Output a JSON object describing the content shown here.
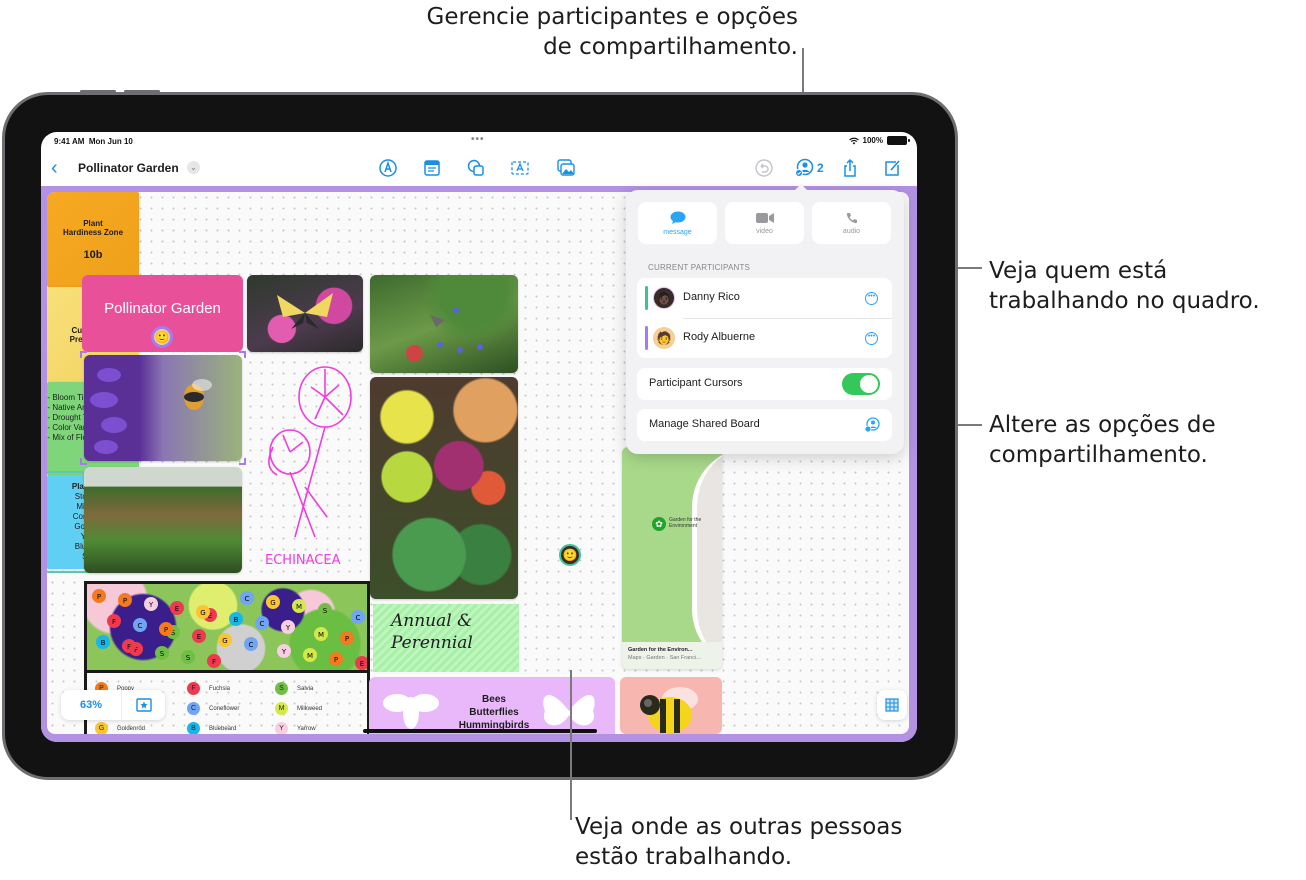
{
  "callouts": {
    "top": [
      "Gerencie participantes e opções",
      "de compartilhamento."
    ],
    "right_1": [
      "Veja quem está",
      "trabalhando no quadro."
    ],
    "right_2": [
      "Altere as opções de",
      "compartilhamento."
    ],
    "bottom": [
      "Veja onde as outras pessoas",
      "estão trabalhando."
    ]
  },
  "status_bar": {
    "time": "9:41 AM",
    "date": "Mon Jun 10",
    "battery": "100%",
    "dots": "•••"
  },
  "toolbar": {
    "back_icon": "chevron-left-icon",
    "title": "Pollinator Garden",
    "title_menu_icon": "chevron-down-icon",
    "tools": [
      "pen-icon",
      "note-icon",
      "shape-icon",
      "text-box-icon",
      "media-icon"
    ],
    "undo_icon": "undo-icon",
    "collaborate_icon": "collaboration-icon",
    "participant_count": "2",
    "share_icon": "share-icon",
    "new_board_icon": "compose-icon"
  },
  "popover": {
    "actions": [
      {
        "label": "message",
        "icon": "message-bubble-icon",
        "active": true
      },
      {
        "label": "video",
        "icon": "video-camera-icon",
        "active": false
      },
      {
        "label": "audio",
        "icon": "phone-icon",
        "active": false
      }
    ],
    "section_label": "CURRENT PARTICIPANTS",
    "participants": [
      {
        "name": "Danny Rico",
        "color": "#3cc29a"
      },
      {
        "name": "Rody Albuerne",
        "color": "#a47cf0"
      }
    ],
    "participant_cursors_label": "Participant Cursors",
    "participant_cursors_on": true,
    "manage_label": "Manage Shared Board"
  },
  "board": {
    "title_card": "Pollinator Garden",
    "sticky_hardiness": {
      "title": "Plant Hardiness Zone",
      "value": "10b"
    },
    "sticky_custom": "Custom vs. Pre-Planned",
    "sticky_criteria": [
      "Bloom Time Range",
      "Native Area Selection",
      "Drought Tolerant",
      "Color Variety",
      "Mix of Flower Structures"
    ],
    "plant_ideas": {
      "title": "Plant Ideas",
      "items": [
        "Stonecrop",
        "Milkweed",
        "Coneflower",
        "Goldenrod",
        "Yarrow",
        "Bluebeard",
        "Salvia"
      ]
    },
    "sketch_label": "ECHINACEA",
    "handwritten": [
      "Annual &",
      "Perennial"
    ],
    "pollinators_card": [
      "Bees",
      "Butterflies",
      "Hummingbirds"
    ],
    "map": {
      "pin_label": "Garden for the Environment",
      "title": "Garden for the Environ...",
      "subtitle": "Maps · Garden · San Franci..."
    },
    "legend": [
      {
        "letter": "P",
        "label": "Poppy",
        "color": "#f47a1f"
      },
      {
        "letter": "F",
        "label": "Fuchsia",
        "color": "#ee3a4f"
      },
      {
        "letter": "S",
        "label": "Salvia",
        "color": "#6fbf44"
      },
      {
        "letter": "C",
        "label": "Coneflower",
        "color": "#6fa5f2"
      },
      {
        "letter": "M",
        "label": "Milkweed",
        "color": "#d4e84a"
      },
      {
        "letter": "G",
        "label": "Goldenrod",
        "color": "#f9c531"
      },
      {
        "letter": "B",
        "label": "Bluebeard",
        "color": "#19b6ea"
      },
      {
        "letter": "Y",
        "label": "Yarrow",
        "color": "#f8cfe0"
      }
    ],
    "zoom_level": "63%"
  },
  "colors": {
    "accent": "#1a8fe3",
    "canvas_border": "#b391e3",
    "toggle_on": "#34c759"
  }
}
